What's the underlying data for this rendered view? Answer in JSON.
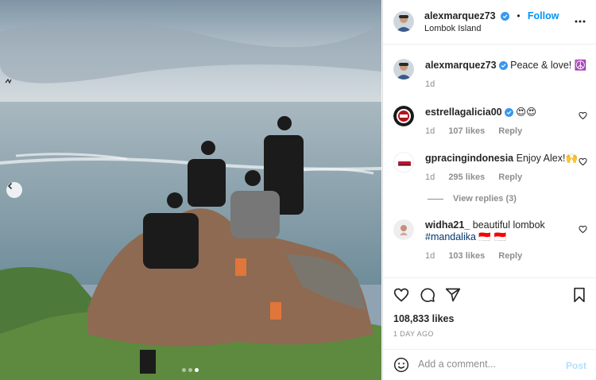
{
  "photo": {
    "dots_count": 3,
    "active_dot": 2
  },
  "post_header": {
    "username": "alexmarquez73",
    "separator": "•",
    "follow_label": "Follow",
    "location": "Lombok Island"
  },
  "caption": {
    "username": "alexmarquez73",
    "text": "Peace & love! ☮️",
    "time": "1d"
  },
  "comments": [
    {
      "username": "estrellagalicia00",
      "verified": true,
      "text": "😍😍",
      "time": "1d",
      "likes": "107 likes",
      "reply_label": "Reply"
    },
    {
      "username": "gpracingindonesia",
      "verified": false,
      "text": "Enjoy Alex!🙌",
      "time": "1d",
      "likes": "295 likes",
      "reply_label": "Reply",
      "view_replies": "View replies (3)"
    },
    {
      "username": "widha21_",
      "verified": false,
      "text": "beautiful lombok",
      "hashtag": "#mandalika",
      "flags": "🇮🇩 🇮🇩",
      "time": "1d",
      "likes": "103 likes",
      "reply_label": "Reply"
    }
  ],
  "actions": {
    "likes": "108,833 likes",
    "time_ago": "1 DAY AGO"
  },
  "add_comment": {
    "placeholder": "Add a comment...",
    "post_label": "Post"
  },
  "colors": {
    "link_blue": "#0095f6",
    "verified_blue": "#3897f0",
    "muted": "#8e8e8e"
  }
}
